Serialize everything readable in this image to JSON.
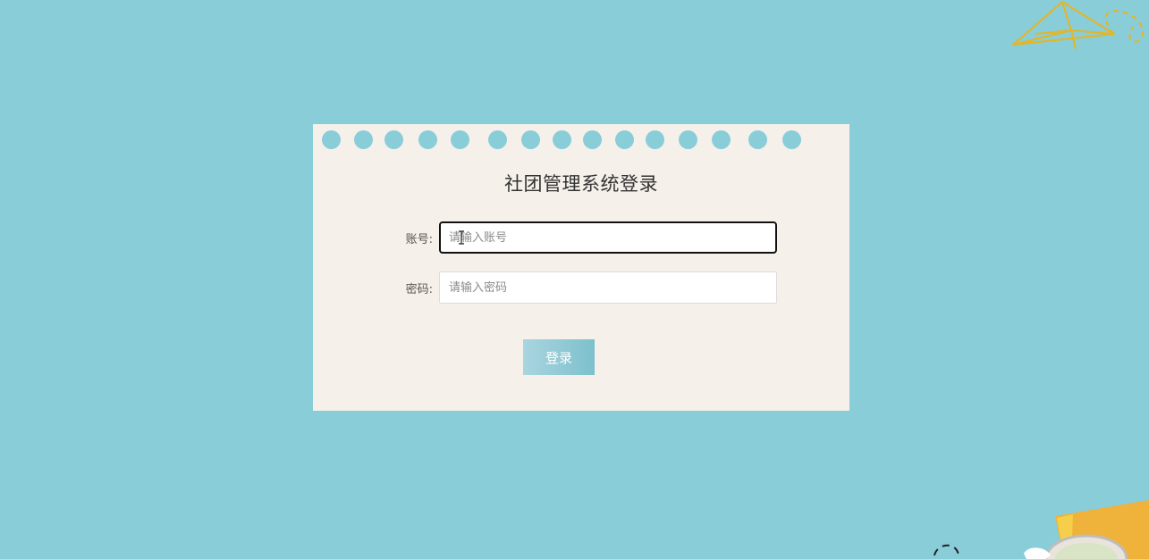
{
  "login": {
    "title": "社团管理系统登录",
    "account_label": "账号:",
    "account_placeholder": "请输入账号",
    "password_label": "密码:",
    "password_placeholder": "请输入密码",
    "submit_label": "登录"
  },
  "colors": {
    "background": "#89cdd9",
    "card": "#f5f0e9",
    "button_start": "#a9d5df",
    "button_end": "#7dc0cd",
    "plane_outline": "#e6b522"
  }
}
